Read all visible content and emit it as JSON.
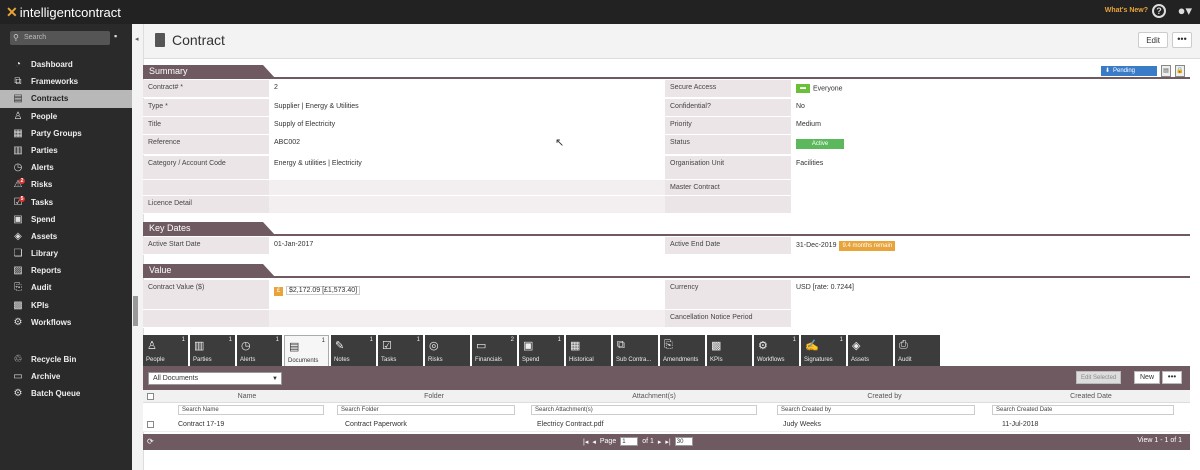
{
  "app": {
    "logo_text": "intelligentcontract",
    "whats_new": "What's New?"
  },
  "sidebar": {
    "search_placeholder": "Search",
    "items": [
      {
        "label": "Dashboard",
        "icon": "dashboard-icon"
      },
      {
        "label": "Frameworks",
        "icon": "frameworks-icon"
      },
      {
        "label": "Contracts",
        "icon": "contracts-icon",
        "active": true
      },
      {
        "label": "People",
        "icon": "people-icon"
      },
      {
        "label": "Party Groups",
        "icon": "party-groups-icon"
      },
      {
        "label": "Parties",
        "icon": "parties-icon"
      },
      {
        "label": "Alerts",
        "icon": "alerts-icon"
      },
      {
        "label": "Risks",
        "icon": "risks-icon",
        "badge": "2"
      },
      {
        "label": "Tasks",
        "icon": "tasks-icon",
        "badge": "5"
      },
      {
        "label": "Spend",
        "icon": "spend-icon"
      },
      {
        "label": "Assets",
        "icon": "assets-icon"
      },
      {
        "label": "Library",
        "icon": "library-icon"
      },
      {
        "label": "Reports",
        "icon": "reports-icon"
      },
      {
        "label": "Audit",
        "icon": "audit-icon"
      },
      {
        "label": "KPIs",
        "icon": "kpis-icon"
      },
      {
        "label": "Workflows",
        "icon": "workflows-icon"
      }
    ],
    "bottom_items": [
      {
        "label": "Recycle Bin",
        "icon": "recycle-bin-icon"
      },
      {
        "label": "Archive",
        "icon": "archive-icon"
      },
      {
        "label": "Batch Queue",
        "icon": "batch-queue-icon"
      }
    ]
  },
  "header": {
    "title": "Contract",
    "edit_label": "Edit",
    "more_label": "•••"
  },
  "summary": {
    "section_title": "Summary",
    "pending_label": "Pending",
    "contract_no_label": "Contract# *",
    "contract_no": "2",
    "type_label": "Type *",
    "type": "Supplier | Energy & Utilities",
    "title_label": "Title",
    "title": "Supply of Electricity",
    "reference_label": "Reference",
    "reference": "ABC002",
    "category_label": "Category / Account Code",
    "category": "Energy & utilities | Electricity",
    "licence_label": "Licence Detail",
    "secure_label": "Secure Access",
    "secure_value": "Everyone",
    "confidential_label": "Confidential?",
    "confidential": "No",
    "priority_label": "Priority",
    "priority": "Medium",
    "status_label": "Status",
    "status": "Active",
    "org_unit_label": "Organisation Unit",
    "org_unit": "Facilities",
    "master_label": "Master Contract"
  },
  "key_dates": {
    "section_title": "Key Dates",
    "start_label": "Active Start Date",
    "start": "01-Jan-2017",
    "end_label": "Active End Date",
    "end": "31-Dec-2019",
    "remaining": "9.4 months remain"
  },
  "value": {
    "section_title": "Value",
    "contract_value_label": "Contract Value ($)",
    "contract_value": "$2,172.09 [£1,573.40]",
    "currency_label": "Currency",
    "currency": "USD [rate: 0.7244]",
    "cancellation_label": "Cancellation Notice Period"
  },
  "tabs": [
    {
      "label": "People",
      "count": "1",
      "icon": "people-icon"
    },
    {
      "label": "Parties",
      "count": "1",
      "icon": "parties-icon"
    },
    {
      "label": "Alerts",
      "count": "1",
      "icon": "alerts-icon"
    },
    {
      "label": "Documents",
      "count": "1",
      "icon": "documents-icon",
      "active": true
    },
    {
      "label": "Notes",
      "count": "1",
      "icon": "notes-icon"
    },
    {
      "label": "Tasks",
      "count": "1",
      "icon": "tasks-icon"
    },
    {
      "label": "Risks",
      "count": "",
      "icon": "risks-icon"
    },
    {
      "label": "Financials",
      "count": "2",
      "icon": "financials-icon"
    },
    {
      "label": "Spend",
      "count": "1",
      "icon": "spend-icon"
    },
    {
      "label": "Historical",
      "count": "",
      "icon": "historical-icon"
    },
    {
      "label": "Sub Contra...",
      "count": "",
      "icon": "sub-contracts-icon"
    },
    {
      "label": "Amendments",
      "count": "",
      "icon": "amendments-icon"
    },
    {
      "label": "KPIs",
      "count": "",
      "icon": "kpis-icon"
    },
    {
      "label": "Workflows",
      "count": "1",
      "icon": "workflows-icon"
    },
    {
      "label": "Signatures",
      "count": "1",
      "icon": "signatures-icon"
    },
    {
      "label": "Assets",
      "count": "",
      "icon": "assets-icon"
    },
    {
      "label": "Audit",
      "count": "",
      "icon": "audit-icon"
    }
  ],
  "documents": {
    "filter_value": "All Documents",
    "edit_selected": "Edit Selected",
    "new_label": "New",
    "more_label": "•••",
    "columns": [
      "Name",
      "Folder",
      "Attachment(s)",
      "Created by",
      "Created Date"
    ],
    "search_placeholders": [
      "Search Name",
      "Search Folder",
      "Search Attachment(s)",
      "Search Created by",
      "Search Created Date"
    ],
    "rows": [
      {
        "name": "Contract 17-19",
        "folder": "Contract Paperwork",
        "attachment": "Electricy Contract.pdf",
        "created_by": "Judy Weeks",
        "created_date": "11-Jul-2018"
      }
    ],
    "pager": {
      "page_label": "Page",
      "page_value": "1",
      "of_label": "of 1",
      "page_size": "30",
      "view_label": "View 1 - 1 of 1"
    }
  }
}
